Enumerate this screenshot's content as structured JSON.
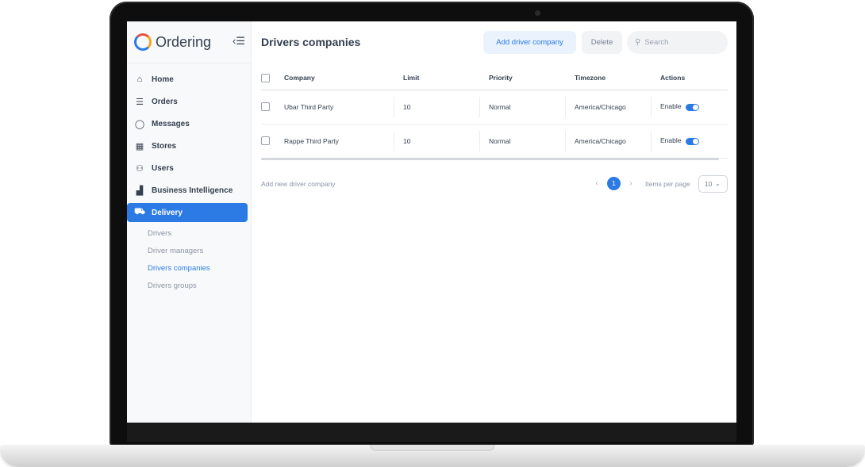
{
  "app": {
    "name": "Ordering"
  },
  "sidebar": {
    "items": [
      {
        "label": "Home",
        "icon": "home-icon",
        "glyph": "⌂"
      },
      {
        "label": "Orders",
        "icon": "list-icon",
        "glyph": "☰"
      },
      {
        "label": "Messages",
        "icon": "chat-icon",
        "glyph": "◯"
      },
      {
        "label": "Stores",
        "icon": "store-icon",
        "glyph": "▦"
      },
      {
        "label": "Users",
        "icon": "users-icon",
        "glyph": "⚇"
      },
      {
        "label": "Business Intelligence",
        "icon": "bar-chart-icon",
        "glyph": "▟"
      },
      {
        "label": "Delivery",
        "icon": "truck-icon",
        "glyph": "⛟"
      }
    ],
    "delivery_sub": [
      {
        "label": "Drivers"
      },
      {
        "label": "Driver managers"
      },
      {
        "label": "Drivers companies"
      },
      {
        "label": "Drivers groups"
      }
    ]
  },
  "header": {
    "title": "Drivers companies",
    "add_label": "Add driver company",
    "delete_label": "Delete",
    "search_placeholder": "Search"
  },
  "table": {
    "columns": [
      "Company",
      "Limit",
      "Priority",
      "Timezone",
      "Actions"
    ],
    "rows": [
      {
        "company": "Ubar Third Party",
        "limit": "10",
        "priority": "Normal",
        "timezone": "America/Chicago",
        "action": "Enable",
        "enabled": true
      },
      {
        "company": "Rappe Third Party",
        "limit": "10",
        "priority": "Normal",
        "timezone": "America/Chicago",
        "action": "Enable",
        "enabled": true
      }
    ]
  },
  "footer": {
    "add_link": "Add new driver company",
    "current_page": "1",
    "items_per_page_label": "Items per page",
    "items_per_page": "10"
  },
  "colors": {
    "accent": "#2c7be5",
    "text": "#344050",
    "muted": "#8a94a6"
  }
}
